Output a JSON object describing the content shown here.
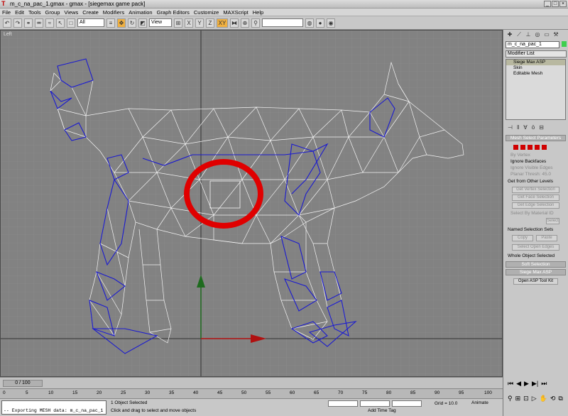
{
  "window": {
    "title": "m_c_na_pac_1.gmax - gmax - [siegemax game pack]",
    "buttons": [
      "_",
      "□",
      "×"
    ]
  },
  "menu": [
    "File",
    "Edit",
    "Tools",
    "Group",
    "Views",
    "Create",
    "Modifiers",
    "Animation",
    "Graph Editors",
    "Customize",
    "MAXScript",
    "Help"
  ],
  "toolbar": {
    "selection_filter": "All",
    "reference_coord": "View",
    "named_selection": ""
  },
  "viewport": {
    "label": "Left",
    "colors": {
      "background": "#828282",
      "grid": "#8e8e8e",
      "mesh": "#ffffff",
      "selected_edges": "#1a1ad0",
      "annotation": "#e00000"
    }
  },
  "command_panel": {
    "object_name": "m_c_na_pac_1",
    "object_color": "#3fcf4f",
    "modifier_list": "Modifier List",
    "stack": [
      "Siege Max ASP",
      "Skin",
      "Editable Mesh"
    ],
    "rollout": "Mesh Select Parameters",
    "options": {
      "by_vertex": "By Vertex",
      "ignore_backfaces": "Ignore Backfaces",
      "ignore_visible_edges": "Ignore Visible Edges",
      "planar_thresh": "Planar Thresh:",
      "planar_value": "45.0"
    },
    "get_from_other_levels": "Get from Other Levels",
    "get_vertex_selection": "Get Vertex Selection",
    "get_face_selection": "Get Face Selection",
    "get_edge_selection": "Get Edge Selection",
    "select_by_material": "Select By Material ID",
    "select_label": "Select",
    "named_selection_sets": "Named Selection Sets",
    "copy": "Copy",
    "paste": "Paste",
    "select_open_edges": "Select Open Edges",
    "whole_object_selected": "Whole Object Selected",
    "soft_selection": "Soft Selection",
    "siege_max_asp": "Siege Max ASP",
    "open_asp_tool_kit": "Open ASP Tool Kit"
  },
  "timeline": {
    "frame": "0 / 100",
    "ticks": [
      "0",
      "5",
      "10",
      "15",
      "20",
      "25",
      "30",
      "35",
      "40",
      "45",
      "50",
      "55",
      "60",
      "65",
      "70",
      "75",
      "80",
      "85",
      "90",
      "95",
      "100"
    ]
  },
  "status": {
    "maxscript_line": "-- Exporting MESH data: m_c_na_pac_1",
    "selection": "1 Object Selected",
    "prompt": "Click and drag to select and move objects",
    "grid": "Grid = 10.0",
    "add_time_tag": "Add Time Tag",
    "animate": "Animate"
  }
}
